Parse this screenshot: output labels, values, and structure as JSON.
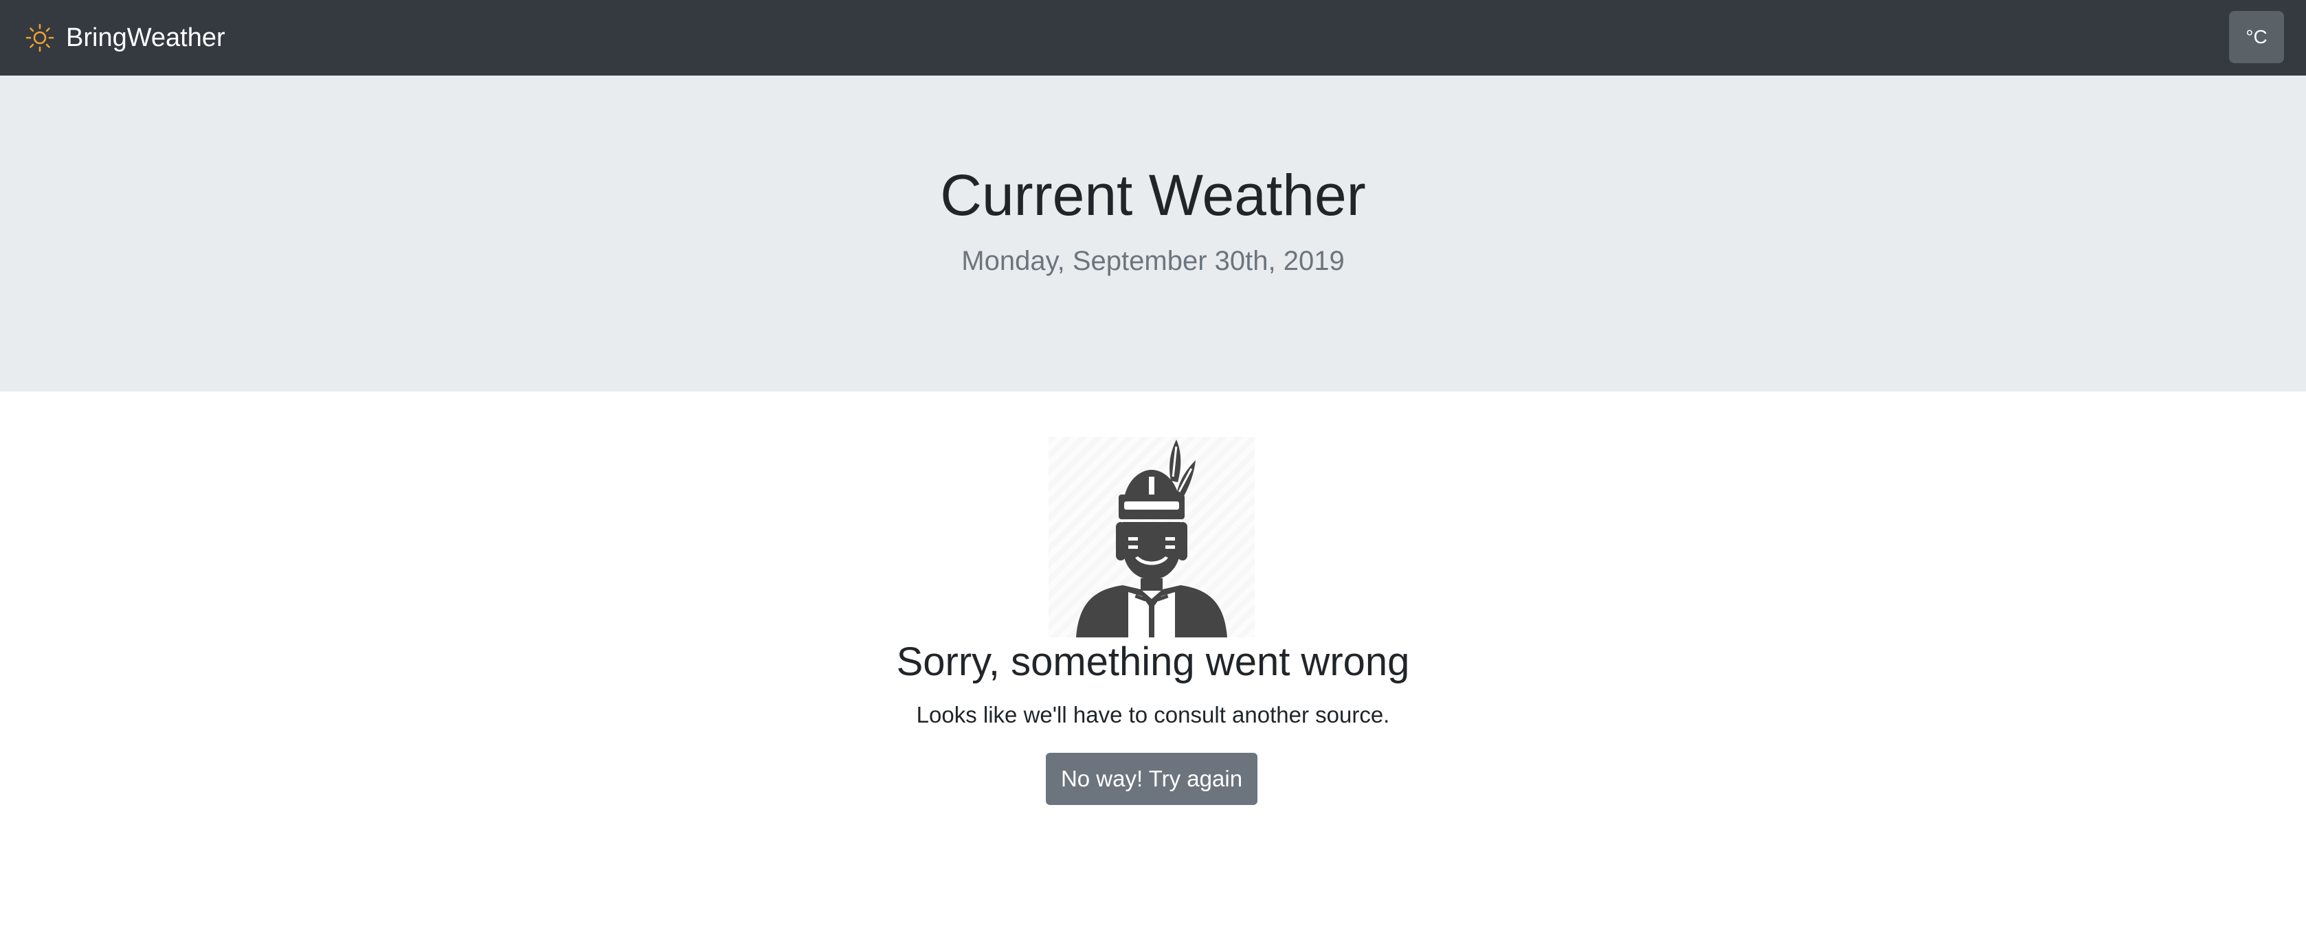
{
  "navbar": {
    "brand_name": "BringWeather",
    "brand_icon": "sun-icon",
    "unit_label": "°C"
  },
  "header": {
    "title": "Current Weather",
    "date": "Monday, September 30th, 2019"
  },
  "error": {
    "illustration_icon": "native-american-person-icon",
    "title": "Sorry, something went wrong",
    "message": "Looks like we'll have to consult another source.",
    "retry_label": "No way! Try again"
  },
  "colors": {
    "navbar_bg": "#343a40",
    "jumbotron_bg": "#e9ecef",
    "sun_icon": "#f0a030",
    "button_secondary": "#6c757d"
  }
}
